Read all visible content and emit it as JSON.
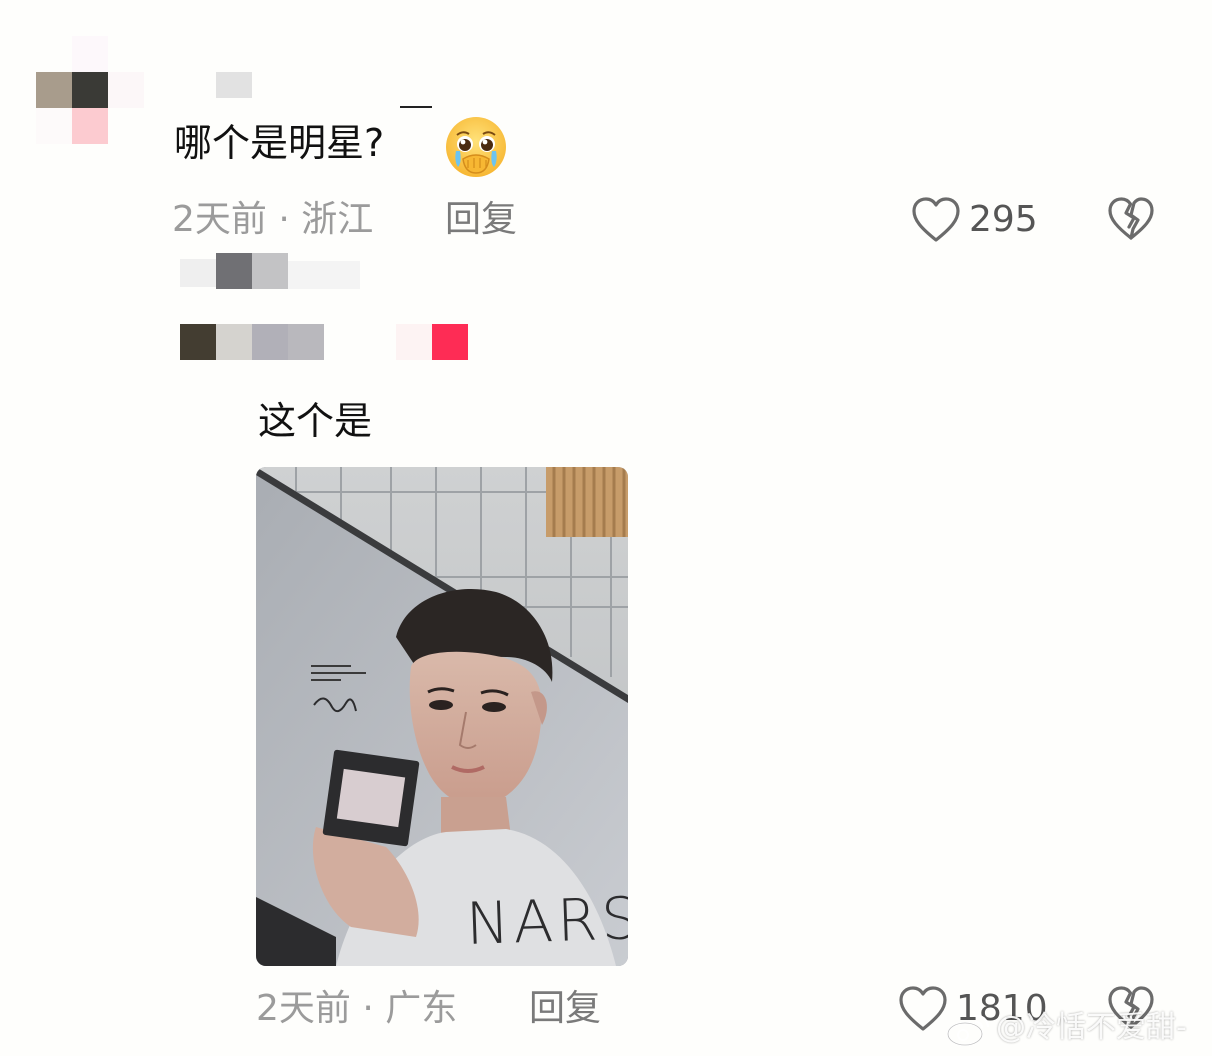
{
  "comments": [
    {
      "text": "哪个是明星?",
      "emoji": "crying-face-emoji",
      "meta": "2天前 · 浙江",
      "reply_label": "回复",
      "likes": "295"
    },
    {
      "text": "这个是",
      "image": {
        "brand_text": "NARS"
      },
      "meta": "2天前 · 广东",
      "reply_label": "回复",
      "likes": "1810"
    }
  ],
  "watermark": "@冷恬不爱甜-",
  "colors": {
    "background": "#fefefc",
    "meta_text": "#9b9b9b",
    "reply_text": "#7a7a7a",
    "icon_stroke": "#6b6b6b",
    "author_badge": "#fe2c55"
  }
}
